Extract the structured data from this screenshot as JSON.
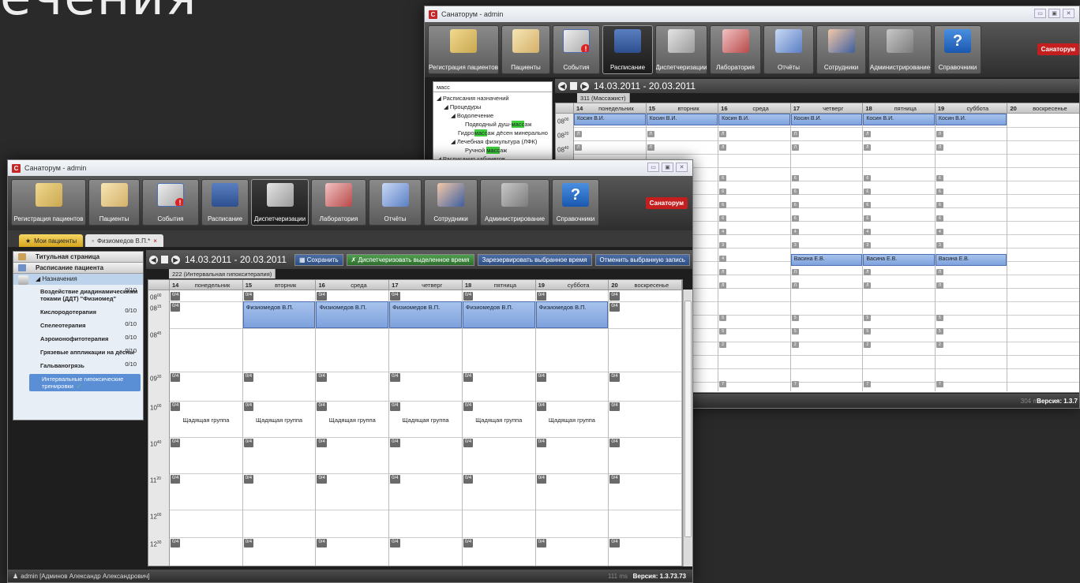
{
  "slide": {
    "title": "ечения"
  },
  "back_window": {
    "title": "Санаторум - admin",
    "toolbar": [
      {
        "label": "Регистрация пациентов",
        "icon": "registration-icon"
      },
      {
        "label": "Пациенты",
        "icon": "patients-icon"
      },
      {
        "label": "События",
        "icon": "events-icon"
      },
      {
        "label": "Расписание",
        "icon": "schedule-icon",
        "active": true
      },
      {
        "label": "Диспетчеризации",
        "icon": "dispatch-icon"
      },
      {
        "label": "Лаборатория",
        "icon": "laboratory-icon"
      },
      {
        "label": "Отчёты",
        "icon": "reports-icon"
      },
      {
        "label": "Сотрудники",
        "icon": "employees-icon"
      },
      {
        "label": "Администрирование",
        "icon": "admin-icon"
      },
      {
        "label": "Справочники",
        "icon": "reference-icon"
      }
    ],
    "logo": "Санаторум",
    "tree": {
      "search_value": "масс",
      "nodes": [
        {
          "text": "◢ Расписания назначений",
          "indent": 0
        },
        {
          "text": "◢ Процедуры",
          "indent": 1
        },
        {
          "text": "◢ Водолечение",
          "indent": 2
        },
        {
          "text_pre": "Подводный душ-",
          "hl": "масс",
          "text_post": "аж",
          "indent": 4
        },
        {
          "text_pre": "Гидро",
          "hl": "масс",
          "text_post": "аж дёсен минерально",
          "indent": 3
        },
        {
          "text": "◢ Лечебная физкультура (ЛФК)",
          "indent": 2
        },
        {
          "text_pre": "Ручной ",
          "hl": "масс",
          "text_post": "аж",
          "indent": 4
        },
        {
          "text": "◢ Расписания кабинетов",
          "indent": 0
        }
      ]
    },
    "range": "14.03.2011 - 20.03.2011",
    "room": "311 (Массажист)",
    "days": [
      {
        "num": "14",
        "name": "понедельник"
      },
      {
        "num": "15",
        "name": "вторник"
      },
      {
        "num": "16",
        "name": "среда"
      },
      {
        "num": "17",
        "name": "четверг"
      },
      {
        "num": "18",
        "name": "пятница"
      },
      {
        "num": "19",
        "name": "суббота"
      },
      {
        "num": "20",
        "name": "воскресенье"
      }
    ],
    "times": [
      {
        "h": "08",
        "m": "00"
      },
      {
        "h": "08",
        "m": "20"
      },
      {
        "h": "08",
        "m": "40"
      },
      {
        "h": "09",
        "m": "00"
      }
    ],
    "events_top": "Косин В.И.",
    "events_mid": "Васина Е.В.",
    "pill_letter": "Л",
    "pill_numbers": [
      "6",
      "6",
      "6",
      "6",
      "4",
      "3",
      "3",
      "4",
      "5",
      "5",
      "2",
      "7"
    ],
    "status_ms": "304 ms",
    "version": "Версия: 1.3.7"
  },
  "front_window": {
    "title": "Санаторум - admin",
    "toolbar": [
      {
        "label": "Регистрация пациентов",
        "icon": "registration-icon"
      },
      {
        "label": "Пациенты",
        "icon": "patients-icon"
      },
      {
        "label": "События",
        "icon": "events-icon"
      },
      {
        "label": "Расписание",
        "icon": "schedule-icon"
      },
      {
        "label": "Диспетчеризации",
        "icon": "dispatch-icon",
        "active": true
      },
      {
        "label": "Лаборатория",
        "icon": "laboratory-icon"
      },
      {
        "label": "Отчёты",
        "icon": "reports-icon"
      },
      {
        "label": "Сотрудники",
        "icon": "employees-icon"
      },
      {
        "label": "Администрирование",
        "icon": "admin-icon"
      },
      {
        "label": "Справочники",
        "icon": "reference-icon"
      }
    ],
    "logo": "Санаторум",
    "tabs": [
      {
        "label": "Мои пациенты",
        "close": ""
      },
      {
        "label": "Физиомедов В.П.*",
        "close": "×"
      }
    ],
    "side": {
      "title_page": "Титульная страница",
      "patient_schedule": "Расписание пациента",
      "assignments": "◢ Назначения",
      "items": [
        {
          "label": "Воздействие диадинамическими токами (ДДТ) \"Физиомед\"",
          "count": "0/10"
        },
        {
          "label": "Кислородотерапия",
          "count": "0/10"
        },
        {
          "label": "Спелеотерапия",
          "count": "0/10"
        },
        {
          "label": "Аэроионофитотерапия",
          "count": "0/10"
        },
        {
          "label": "Грязевые аппликации на дёсны",
          "count": "0/10"
        },
        {
          "label": "Гальваногрязь",
          "count": "0/10"
        }
      ],
      "selected": "Интервальные гипоксические тренировки",
      "selected_check": "✓"
    },
    "range": "14.03.2011 - 20.03.2011",
    "buttons": {
      "save": "Сохранить",
      "dispatch": "Диспетчеризовать выделенное время",
      "reserve": "Зарезервировать выбранное время",
      "cancel": "Отменить выбранную запись"
    },
    "room": "222 (Интервальная гипокситерапия)",
    "days": [
      {
        "num": "14",
        "name": "понедельник"
      },
      {
        "num": "15",
        "name": "вторник"
      },
      {
        "num": "16",
        "name": "среда"
      },
      {
        "num": "17",
        "name": "четверг"
      },
      {
        "num": "18",
        "name": "пятница"
      },
      {
        "num": "19",
        "name": "суббота"
      },
      {
        "num": "20",
        "name": "воскресенье"
      }
    ],
    "times": [
      {
        "h": "08",
        "m": "00"
      },
      {
        "h": "08",
        "m": "15"
      },
      {
        "h": "08",
        "m": "45"
      },
      {
        "h": "09",
        "m": "30"
      },
      {
        "h": "10",
        "m": "00"
      },
      {
        "h": "10",
        "m": "40"
      },
      {
        "h": "11",
        "m": "20"
      },
      {
        "h": "12",
        "m": "00"
      },
      {
        "h": "12",
        "m": "30"
      }
    ],
    "slot_label": "0/4",
    "patient_event": "Физиомедов В.П.",
    "group_label": "Щадящая группа",
    "status_user": "admin [Админов Александр Александрович]",
    "status_ms": "111 ms",
    "version": "Версия: 1.3.73.73"
  }
}
